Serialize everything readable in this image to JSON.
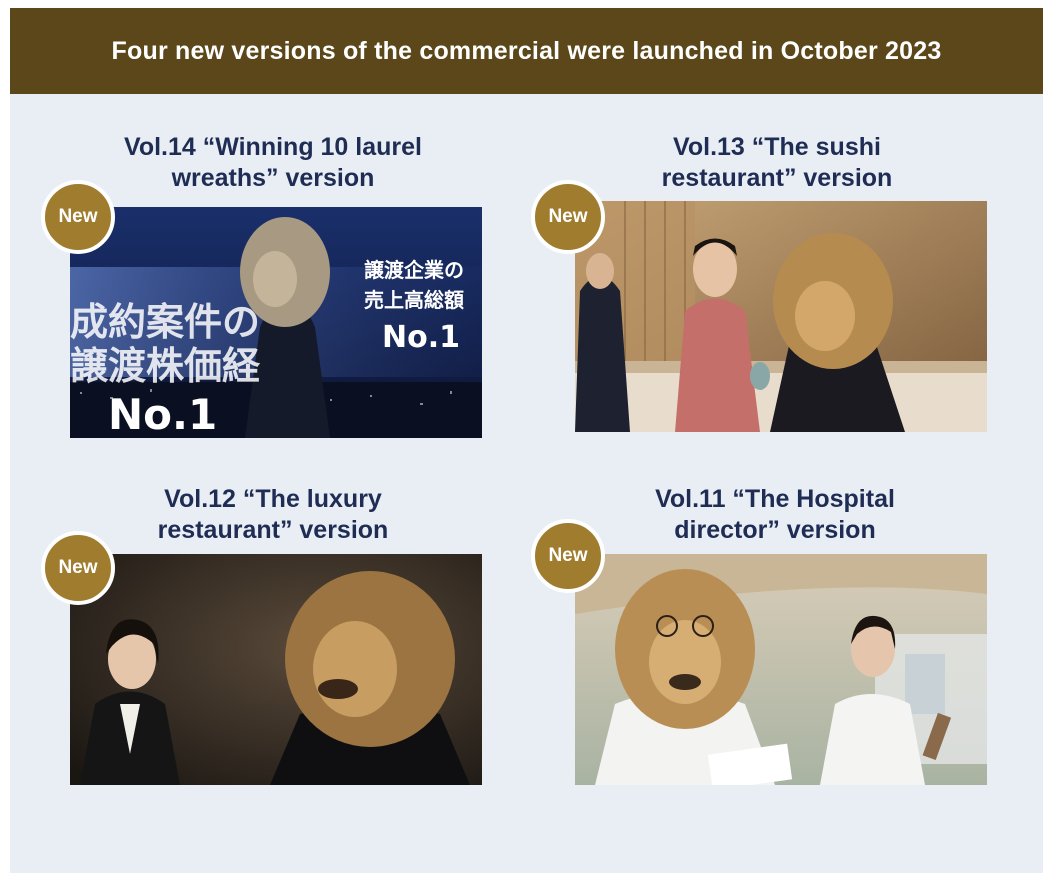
{
  "header": {
    "title": "Four new versions of the commercial were launched in October 2023"
  },
  "badge_label": "New",
  "commercials": [
    {
      "title_line1": "Vol.14 “Winning 10 laurel",
      "title_line2": "wreaths” version",
      "screen_text": {
        "left_line1": "成約案件の",
        "left_line2": "譲渡株価経",
        "left_line3": "No.1",
        "right_line1": "譲渡企業の",
        "right_line2": "売上高総額",
        "right_line3": "No.1"
      }
    },
    {
      "title_line1": "Vol.13 “The sushi",
      "title_line2": "restaurant” version"
    },
    {
      "title_line1": "Vol.12 “The luxury",
      "title_line2": "restaurant” version"
    },
    {
      "title_line1": "Vol.11 “The Hospital",
      "title_line2": "director” version"
    }
  ],
  "colors": {
    "banner": "#5b4719",
    "badge": "#a07c2e",
    "title": "#1f2d55",
    "background": "#e9eef5"
  }
}
